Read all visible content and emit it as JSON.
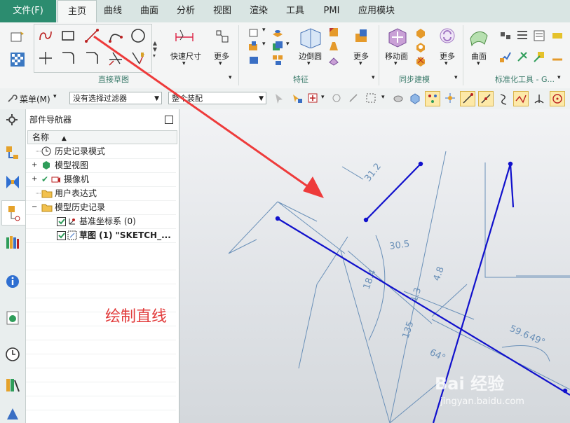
{
  "menubar": {
    "file": "文件(F)",
    "tabs": [
      "主页",
      "曲线",
      "曲面",
      "分析",
      "视图",
      "渲染",
      "工具",
      "PMI",
      "应用模块"
    ]
  },
  "ribbon": {
    "groups": {
      "direct_sketch": "直接草图",
      "feature": "特征",
      "sync_modeling": "同步建模",
      "std_tools": "标准化工具 - G..."
    },
    "labels": {
      "quick_dim": "快速尺寸",
      "more1": "更多",
      "edge_blend": "边倒圆",
      "more2": "更多",
      "move_face": "移动面",
      "more3": "更多",
      "surface": "曲面"
    }
  },
  "toolbar2": {
    "menu": "菜单(M)",
    "filter": "没有选择过滤器",
    "scope": "整个装配"
  },
  "navigator": {
    "title": "部件导航器",
    "column": "名称",
    "rows": [
      {
        "label": "历史记录模式"
      },
      {
        "label": "模型视图"
      },
      {
        "label": "摄像机"
      },
      {
        "label": "用户表达式"
      },
      {
        "label": "模型历史记录"
      },
      {
        "label": "基准坐标系 (0)"
      },
      {
        "label": "草图 (1) \"SKETCH_..."
      }
    ]
  },
  "annotation": "绘制直线",
  "dims": [
    "31.2",
    "30.5",
    "18.4",
    "4.8",
    "1.3",
    "135",
    "64°",
    "59.6",
    "49°"
  ],
  "watermark": {
    "brand": "Bai 经验",
    "url": "jingyan.baidu.com"
  },
  "colors": {
    "accent": "#2c8c6f",
    "sketch": "#1111cc",
    "dim": "#6a90b8",
    "arrow": "#ee3b3b"
  }
}
